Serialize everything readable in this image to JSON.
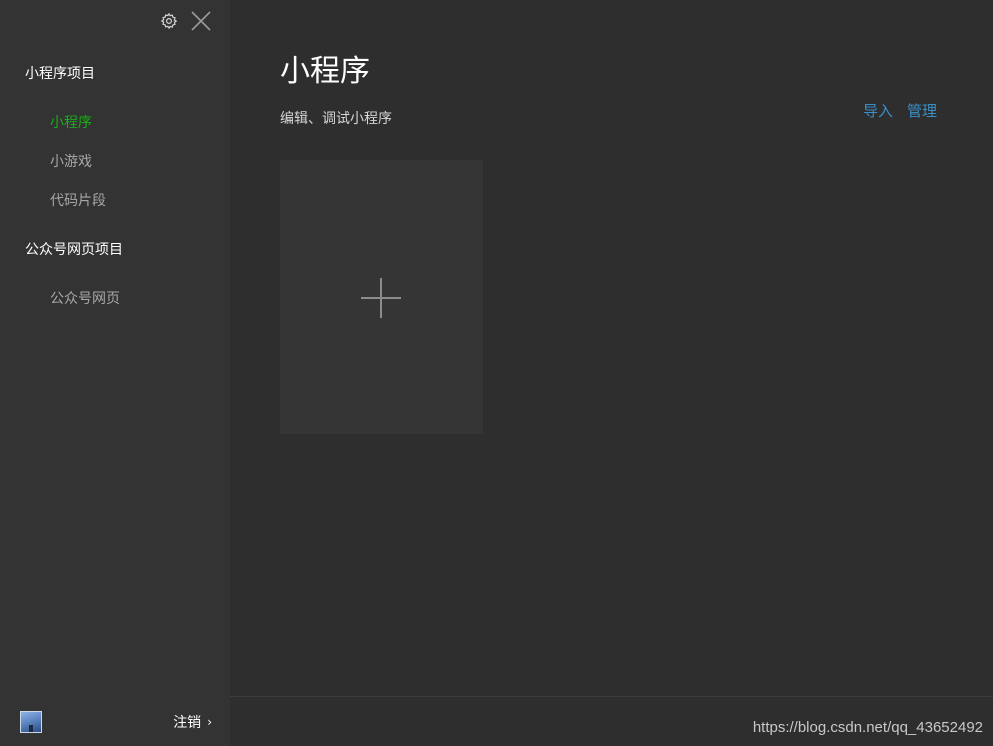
{
  "sidebar": {
    "window_controls": {
      "settings_icon": "gear-icon",
      "close_icon": "close-icon"
    },
    "sections": [
      {
        "title": "小程序项目",
        "items": [
          {
            "label": "小程序",
            "active": true
          },
          {
            "label": "小游戏"
          },
          {
            "label": "代码片段"
          }
        ]
      },
      {
        "title": "公众号网页项目",
        "items": [
          {
            "label": "公众号网页"
          }
        ]
      }
    ],
    "footer": {
      "logout_label": "注销",
      "chevron": "›"
    }
  },
  "main": {
    "title": "小程序",
    "subtitle": "编辑、调试小程序",
    "actions": {
      "import_label": "导入",
      "manage_label": "管理"
    },
    "new_project_icon": "plus-icon"
  },
  "watermark": "https://blog.csdn.net/qq_43652492",
  "colors": {
    "accent_active": "#1aad19",
    "link": "#3b8fc7",
    "sidebar_bg": "#333333",
    "main_bg": "#2e2e2e"
  }
}
